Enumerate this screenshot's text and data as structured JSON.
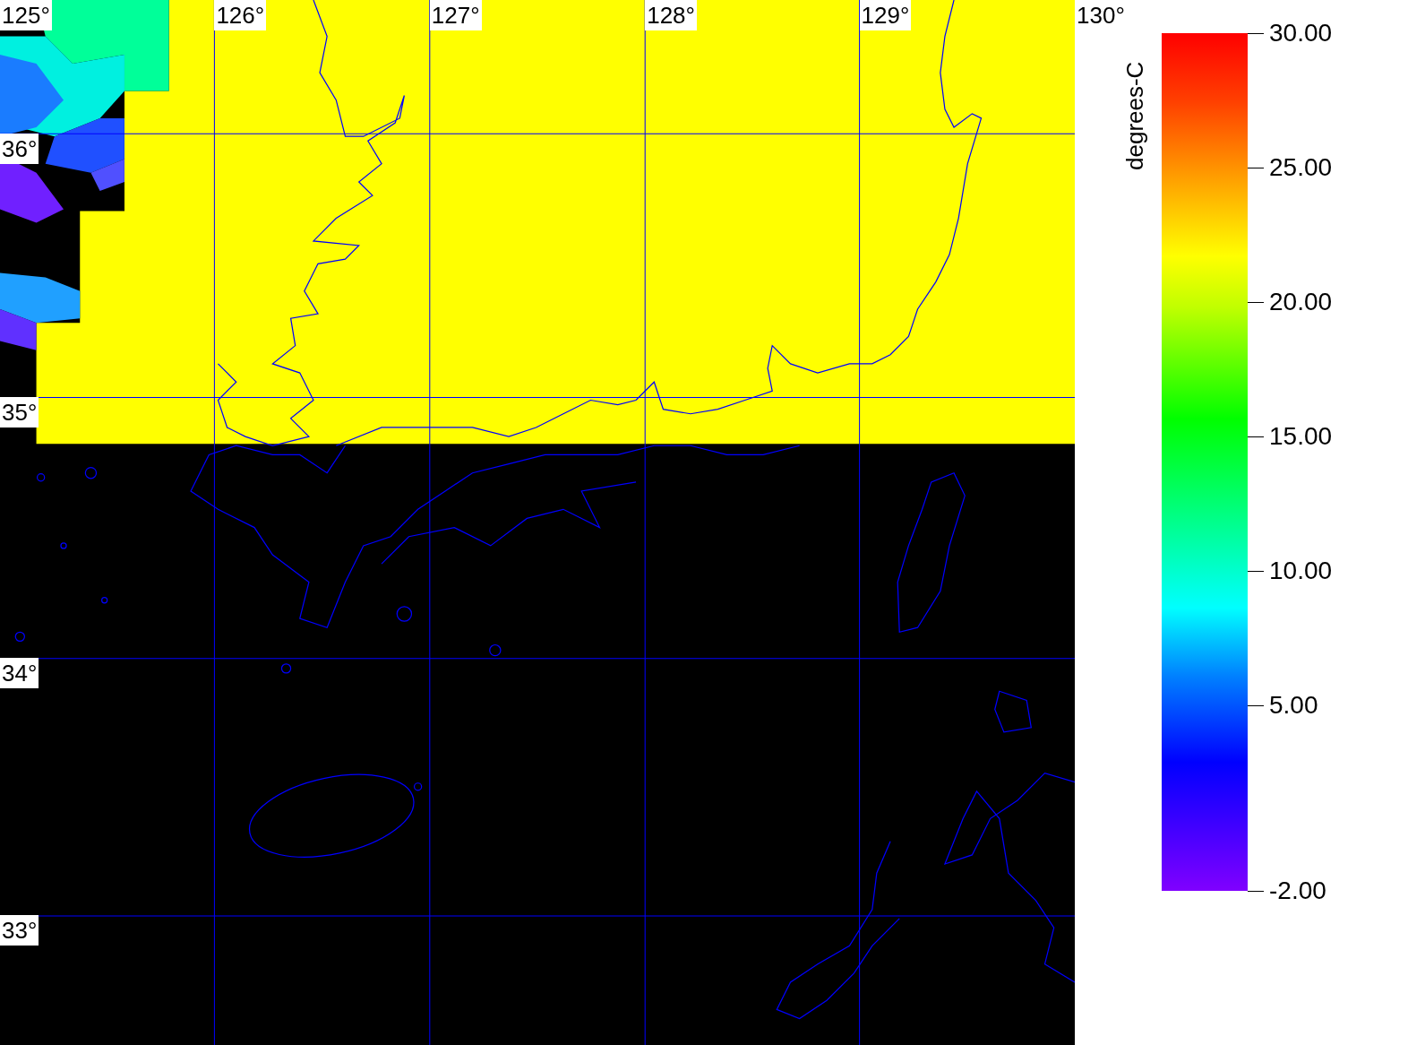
{
  "map": {
    "lon_labels": [
      "125°",
      "126°",
      "127°",
      "128°",
      "129°",
      "130°"
    ],
    "lat_labels": [
      "36°",
      "35°",
      "34°",
      "33°"
    ]
  },
  "colorbar": {
    "title": "degrees-C",
    "ticks": [
      "30.00",
      "25.00",
      "20.00",
      "15.00",
      "10.00",
      "5.00",
      "-2.00"
    ]
  }
}
